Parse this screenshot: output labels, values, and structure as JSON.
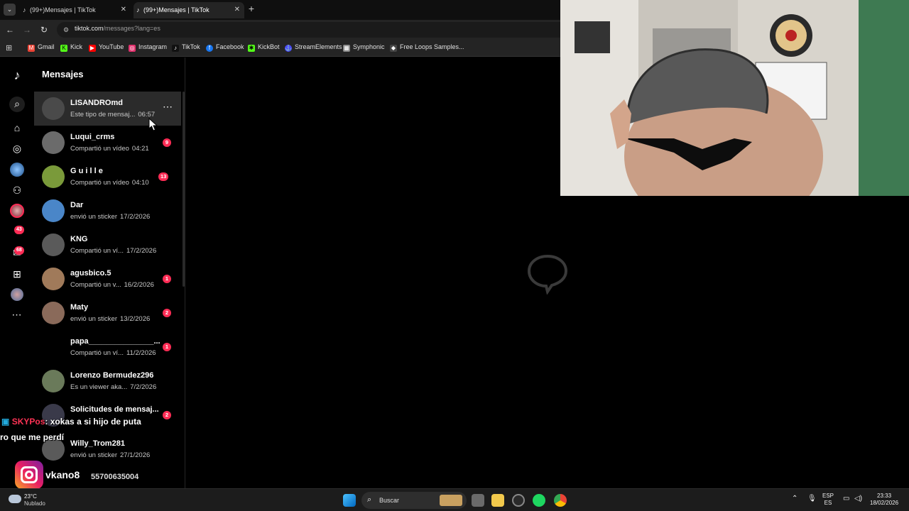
{
  "browser": {
    "tabs": [
      {
        "title": "(99+)Mensajes | TikTok",
        "active": false
      },
      {
        "title": "(99+)Mensajes | TikTok",
        "active": true
      }
    ],
    "url_host": "tiktok.com",
    "url_path": "/messages?lang=es",
    "bookmarks": [
      {
        "label": "Gmail",
        "icon": "gmail-icon",
        "color": "#ea4335"
      },
      {
        "label": "Kick",
        "icon": "kick-icon",
        "color": "#53fc18"
      },
      {
        "label": "YouTube",
        "icon": "youtube-icon",
        "color": "#ff0000"
      },
      {
        "label": "Instagram",
        "icon": "instagram-icon",
        "color": "#e1306c"
      },
      {
        "label": "TikTok",
        "icon": "tiktok-icon",
        "color": "#000000"
      },
      {
        "label": "Facebook",
        "icon": "facebook-icon",
        "color": "#1877f2"
      },
      {
        "label": "KickBot",
        "icon": "kickbot-icon",
        "color": "#53fc18"
      },
      {
        "label": "StreamElements",
        "icon": "streamelements-icon",
        "color": "#4b4bff"
      },
      {
        "label": "Symphonic",
        "icon": "symphonic-icon",
        "color": "#888888"
      },
      {
        "label": "Free Loops Samples...",
        "icon": "freeloops-icon",
        "color": "#666666"
      }
    ]
  },
  "rail": {
    "likes_badge": "43",
    "messages_badge": "68"
  },
  "messages": {
    "title": "Mensajes",
    "conversations": [
      {
        "name": "LISANDROmd",
        "preview": "Este tipo de mensaj...",
        "time": "06:57",
        "unread": "",
        "selected": true,
        "avatar_color": "#4a4a4a"
      },
      {
        "name": "Luqui_crms",
        "preview": "Compartió un vídeo",
        "time": "04:21",
        "unread": "9",
        "selected": false,
        "avatar_color": "#6b6b6b"
      },
      {
        "name": "G u i l l e",
        "preview": "Compartió un vídeo",
        "time": "04:10",
        "unread": "13",
        "selected": false,
        "avatar_color": "#7a9a3a"
      },
      {
        "name": "Dar",
        "preview": "envió un sticker",
        "time": "17/2/2026",
        "unread": "",
        "selected": false,
        "avatar_color": "#4a86c8"
      },
      {
        "name": "KNG",
        "preview": "Compartió un ví...",
        "time": "17/2/2026",
        "unread": "",
        "selected": false,
        "avatar_color": "#5a5a5a"
      },
      {
        "name": "agusbico.5",
        "preview": "Compartió un v...",
        "time": "16/2/2026",
        "unread": "1",
        "selected": false,
        "avatar_color": "#a07a5a"
      },
      {
        "name": "Maty",
        "preview": "envió un sticker",
        "time": "13/2/2026",
        "unread": "2",
        "selected": false,
        "avatar_color": "#8a6a5a"
      },
      {
        "name": "papa_______________...",
        "preview": "Compartió un ví...",
        "time": "11/2/2026",
        "unread": "1",
        "selected": false,
        "avatar_color": "#000000"
      },
      {
        "name": "Lorenzo Bermudez296",
        "preview": "Es un viewer aka...",
        "time": "7/2/2026",
        "unread": "",
        "selected": false,
        "avatar_color": "#6a7a5a"
      },
      {
        "name": "Solicitudes de mensaj...",
        "preview": "",
        "time": "",
        "unread": "2",
        "selected": false,
        "avatar_color": "#3a3a4a"
      },
      {
        "name": "Willy_Trom281",
        "preview": "envió un sticker",
        "time": "27/1/2026",
        "unread": "",
        "selected": false,
        "avatar_color": "#5a5a5a"
      }
    ]
  },
  "overlay": {
    "chat_user": "SKYPos",
    "chat_line1": ": xokas a si hijo de puta",
    "chat_line2": "ro que me perdí",
    "instagram_handle": "vkano8",
    "phone_line": "55700635004"
  },
  "taskbar": {
    "temperature": "23°C",
    "weather": "Nublado",
    "search_placeholder": "Buscar",
    "lang_top": "ESP",
    "lang_bottom": "ES",
    "time": "23:33",
    "date": "18/02/2026"
  }
}
